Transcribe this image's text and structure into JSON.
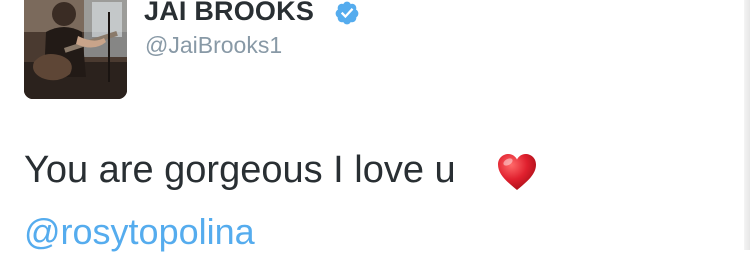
{
  "tweet": {
    "author": {
      "display_name": "JAI BROOKS",
      "handle": "@JaiBrooks1",
      "verified": true,
      "avatar_icon": "profile-photo-guitarist"
    },
    "text": "You are gorgeous I love u",
    "emoji_icon": "red-heart-icon",
    "mention": "@rosytopolina"
  },
  "colors": {
    "name_text": "#292f33",
    "handle_text": "#8899a6",
    "body_text": "#292f33",
    "link": "#55acee",
    "verified_badge": "#55acee",
    "heart": "#e0202e"
  }
}
